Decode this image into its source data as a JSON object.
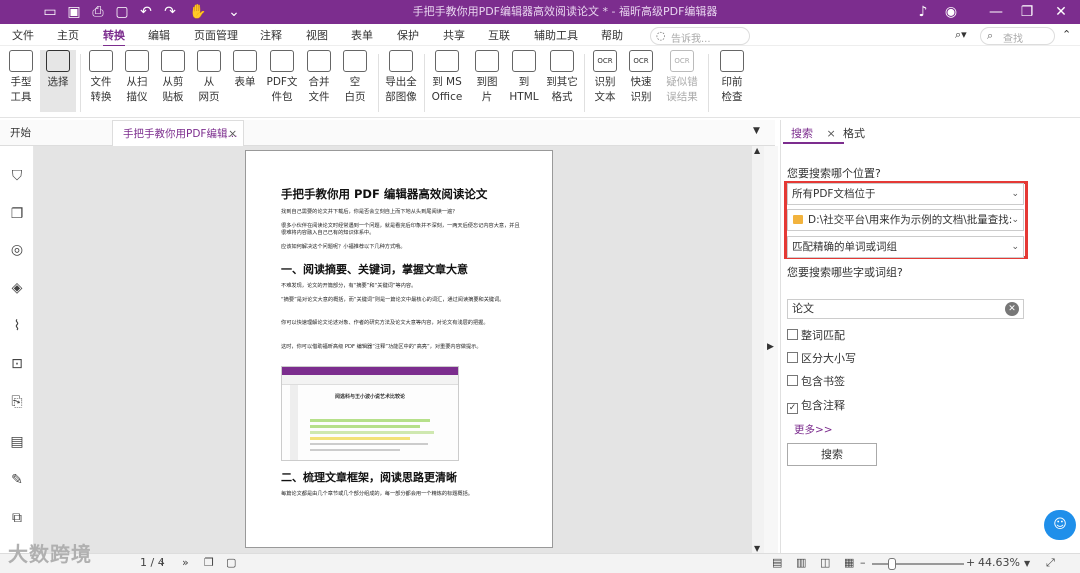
{
  "titlebar": {
    "title": "手把手教你用PDF编辑器高效阅读论文 * - 福昕高级PDF编辑器",
    "bg": "#7c2d8e"
  },
  "menu": [
    "文件",
    "主页",
    "转换",
    "编辑",
    "页面管理",
    "注释",
    "视图",
    "表单",
    "保护",
    "共享",
    "互联",
    "辅助工具",
    "帮助"
  ],
  "menu_active": "转换",
  "help_search_placeholder": "告诉我...",
  "find_placeholder": "查找",
  "ribbon": [
    {
      "label": "手型\n工具"
    },
    {
      "label": "选择"
    },
    {
      "label": "文件\n转换"
    },
    {
      "label": "从扫\n描仪"
    },
    {
      "label": "从剪\n贴板"
    },
    {
      "label": "从\n网页"
    },
    {
      "label": "表单"
    },
    {
      "label": "PDF文\n件包"
    },
    {
      "label": "合并\n文件"
    },
    {
      "label": "空\n白页"
    },
    {
      "label": "导出全\n部图像"
    },
    {
      "label": "到 MS\nOffice"
    },
    {
      "label": "到图\n片"
    },
    {
      "label": "到\nHTML"
    },
    {
      "label": "到其它\n格式"
    },
    {
      "label": "识别\n文本"
    },
    {
      "label": "快速\n识别"
    },
    {
      "label": "疑似错\n误结果"
    },
    {
      "label": "印前\n检查"
    }
  ],
  "ocr_label": "OCR",
  "tabs": {
    "start": "开始",
    "doc": "手把手教你用PDF编辑...",
    "close": "×"
  },
  "doc": {
    "title": "手把手教你用 PDF 编辑器高效阅读论文",
    "p1": "找到自己需要的论文并下载后，你是否会立刻自上而下地从头到尾阅读一遍？",
    "p2": "很多小伙伴在阅读论文时经常遇到一个问题，就是看完后印象并不深刻，一两天后便忘记内容大意，并且很难将内容融入自己已有的知识体系中。",
    "p3": "应该如何解决这个问题呢？小福推荐以下几种方式哦。",
    "h1": "一、阅读摘要、关键词，掌握文章大意",
    "p4": "不难发现，论文的开篇部分，有“摘要”和“关键词”等内容。",
    "p5": "“摘要”是对论文大意的概括，而“关键词”则是一篇论文中最核心的词汇，通过阅读摘要和关键词。",
    "p6": "你可以快速理解论文论述对象、作者的研究方法及论文大意等内容，对论文有浅层的把握。",
    "p7": "这时，你可以借助福昕高级 PDF 编辑器“注释”功能区中的“高亮”，对重要内容做提示。",
    "thumb_title": "阅逃科与王小波小说艺术比较论",
    "h2": "二、梳理文章框架，阅读思路更清晰",
    "p8": "每篇论文都是由几个章节或几个部分组成的，每一部分都会用一个精炼的标题概括。"
  },
  "search": {
    "tab_search": "搜索",
    "tab_format": "格式",
    "close": "×",
    "where_label": "您要搜索哪个位置?",
    "scope": "所有PDF文档位于",
    "path": "D:\\社交平台\\用来作为示例的文档\\批量查找:",
    "match_mode": "匹配精确的单词或词组",
    "what_label": "您要搜索哪些字或词组?",
    "query": "论文",
    "options": [
      {
        "label": "整词匹配",
        "checked": false
      },
      {
        "label": "区分大小写",
        "checked": false
      },
      {
        "label": "包含书签",
        "checked": false
      },
      {
        "label": "包含注释",
        "checked": true
      }
    ],
    "more": "更多>>",
    "button": "搜索",
    "highlight_color": "#e53935"
  },
  "status": {
    "page": "1 / 4",
    "zoom": "44.63%"
  },
  "watermark": "大数跨境"
}
